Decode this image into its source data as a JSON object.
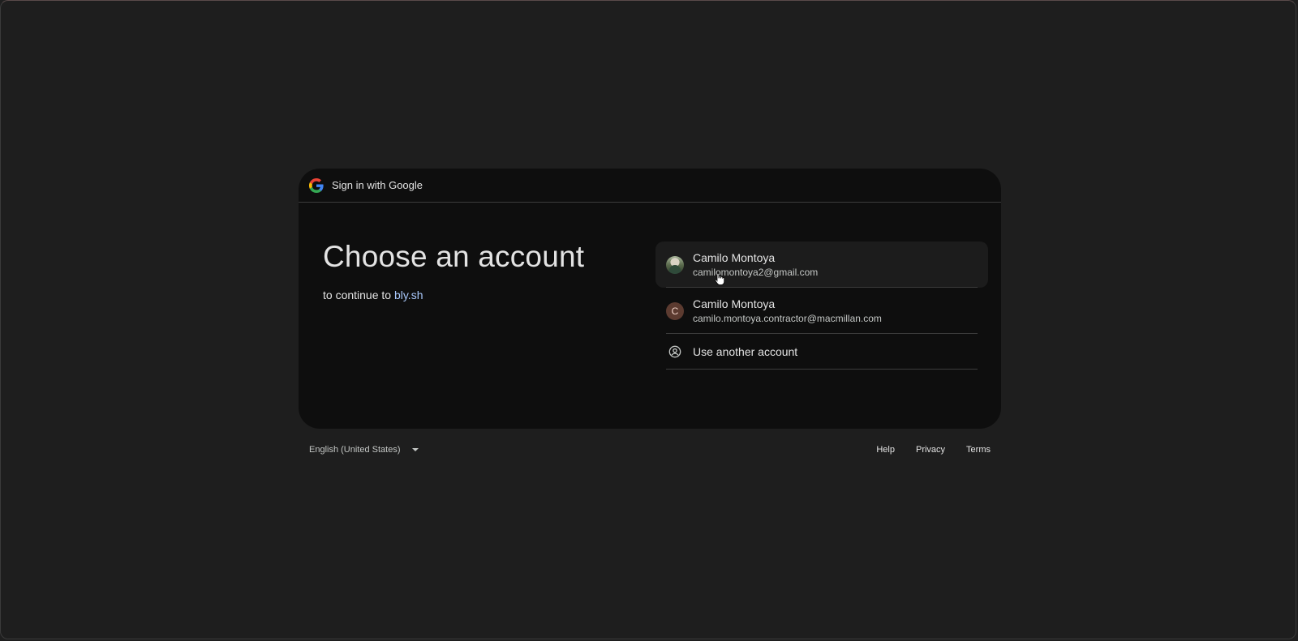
{
  "header": {
    "title": "Sign in with Google",
    "logo_icon": "google-g-icon"
  },
  "main": {
    "title": "Choose an account",
    "subtitle_prefix": "to continue to",
    "site_name": "bly.sh"
  },
  "accounts": [
    {
      "name": "Camilo Montoya",
      "email": "camilomontoya2@gmail.com",
      "avatar": "photo",
      "hovered": true
    },
    {
      "name": "Camilo Montoya",
      "email": "camilo.montoya.contractor@macmillan.com",
      "avatar_letter": "C",
      "avatar_color": "#5c3b30"
    }
  ],
  "use_another": {
    "label": "Use another account",
    "icon": "account-circle-icon"
  },
  "footer": {
    "language": "English (United States)",
    "links": [
      "Help",
      "Privacy",
      "Terms"
    ]
  },
  "colors": {
    "background": "#1f1f1f",
    "card": "#0e0e0e",
    "link": "#a8c7fa",
    "text": "#e3e3e3"
  }
}
